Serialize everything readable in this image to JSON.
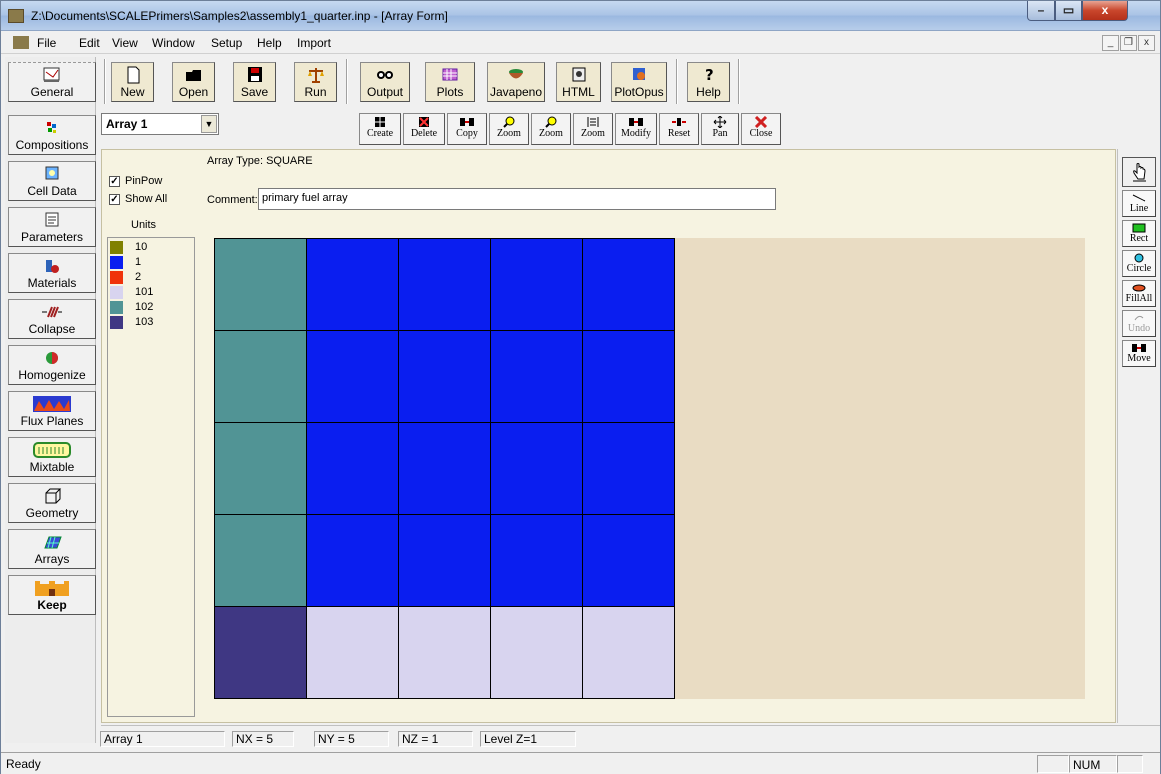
{
  "window": {
    "title": "Z:\\Documents\\SCALEPrimers\\Samples2\\assembly1_quarter.inp - [Array Form]",
    "min": "–",
    "max": "▭",
    "close": "x"
  },
  "menu": [
    "File",
    "Edit",
    "View",
    "Window",
    "Setup",
    "Help",
    "Import"
  ],
  "mdi": {
    "min": "_",
    "restore": "❐",
    "close": "x"
  },
  "sidebar": [
    {
      "label": "General",
      "icon": "general-icon"
    },
    {
      "label": "Compositions",
      "icon": "compositions-icon"
    },
    {
      "label": "Cell Data",
      "icon": "cell-data-icon"
    },
    {
      "label": "Parameters",
      "icon": "parameters-icon"
    },
    {
      "label": "Materials",
      "icon": "materials-icon"
    },
    {
      "label": "Collapse",
      "icon": "collapse-icon"
    },
    {
      "label": "Homogenize",
      "icon": "homogenize-icon"
    },
    {
      "label": "Flux Planes",
      "icon": "flux-planes-icon"
    },
    {
      "label": "Mixtable",
      "icon": "mixtable-icon"
    },
    {
      "label": "Geometry",
      "icon": "geometry-icon"
    },
    {
      "label": "Arrays",
      "icon": "arrays-icon"
    },
    {
      "label": "Keep",
      "icon": "keep-icon"
    }
  ],
  "toolbar": [
    {
      "label": "New"
    },
    {
      "label": "Open"
    },
    {
      "label": "Save"
    },
    {
      "label": "Run"
    },
    {
      "label": "Output"
    },
    {
      "label": "Plots"
    },
    {
      "label": "Javapeno"
    },
    {
      "label": "HTML"
    },
    {
      "label": "PlotOpus"
    },
    {
      "label": "Help"
    }
  ],
  "array_select": {
    "value": "Array 1",
    "arrow": "▼"
  },
  "array_toolbar": [
    "Create",
    "Delete",
    "Copy",
    "Zoom",
    "Zoom",
    "Zoom",
    "Modify",
    "Reset",
    "Pan",
    "Close"
  ],
  "form": {
    "array_type": "Array Type: SQUARE",
    "comment_label": "Comment:",
    "comment_value": "primary fuel array",
    "pinpow_label": "PinPow",
    "pinpow_checked": "✓",
    "showall_label": "Show All",
    "showall_checked": "✓",
    "units_label": "Units"
  },
  "units": [
    {
      "label": "10",
      "color": "#808000"
    },
    {
      "label": "1",
      "color": "#0a1ef0"
    },
    {
      "label": "2",
      "color": "#f0330a"
    },
    {
      "label": "101",
      "color": "#d8d4ef"
    },
    {
      "label": "102",
      "color": "#519495"
    },
    {
      "label": "103",
      "color": "#3f3783"
    }
  ],
  "grid": {
    "nx": 5,
    "ny": 5,
    "rows": [
      [
        "102",
        "1",
        "1",
        "1",
        "1"
      ],
      [
        "102",
        "1",
        "1",
        "1",
        "1"
      ],
      [
        "102",
        "1",
        "1",
        "1",
        "1"
      ],
      [
        "102",
        "1",
        "1",
        "1",
        "1"
      ],
      [
        "103",
        "101",
        "101",
        "101",
        "101"
      ]
    ]
  },
  "draw_tools": [
    "",
    "Line",
    "Rect",
    "Circle",
    "FillAll",
    "Undo",
    "Move"
  ],
  "status_fields": {
    "array": "Array 1",
    "nx": "NX = 5",
    "ny": "NY =  5",
    "nz": "NZ = 1",
    "level": "Level Z=1"
  },
  "statusbar": {
    "ready": "Ready",
    "num": "NUM"
  }
}
